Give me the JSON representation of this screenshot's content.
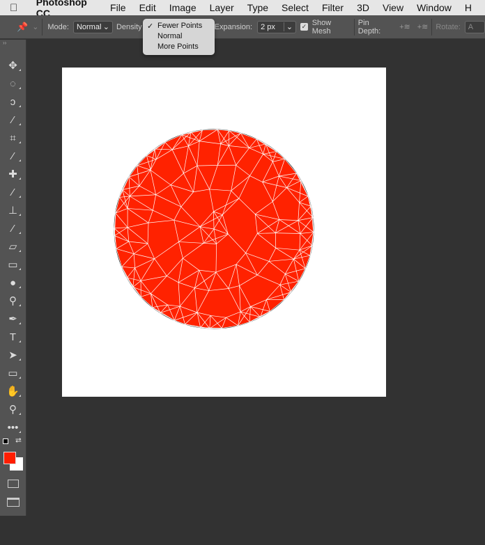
{
  "menubar": {
    "apple": "",
    "app": "Photoshop CC",
    "items": [
      "File",
      "Edit",
      "Image",
      "Layer",
      "Type",
      "Select",
      "Filter",
      "3D",
      "View",
      "Window",
      "H"
    ]
  },
  "options": {
    "mode_label": "Mode:",
    "mode_value": "Normal",
    "density_label": "Density",
    "expansion_label": "Expansion:",
    "expansion_value": "2 px",
    "show_mesh_label": "Show Mesh",
    "show_mesh_checked": true,
    "pin_depth_label": "Pin Depth:",
    "rotate_label": "Rotate:",
    "rotate_value": "A"
  },
  "density_menu": {
    "items": [
      "Fewer Points",
      "Normal",
      "More Points"
    ],
    "selected": "Fewer Points"
  },
  "tools": [
    {
      "name": "move",
      "glyph": "✥"
    },
    {
      "name": "marquee",
      "glyph": "◌"
    },
    {
      "name": "lasso",
      "glyph": "ↄ"
    },
    {
      "name": "magic-wand",
      "glyph": "⁄"
    },
    {
      "name": "crop",
      "glyph": "⌗"
    },
    {
      "name": "eyedropper",
      "glyph": "⁄"
    },
    {
      "name": "healing",
      "glyph": "✚"
    },
    {
      "name": "brush",
      "glyph": "⁄"
    },
    {
      "name": "stamp",
      "glyph": "⊥"
    },
    {
      "name": "history-brush",
      "glyph": "⁄"
    },
    {
      "name": "eraser",
      "glyph": "▱"
    },
    {
      "name": "gradient",
      "glyph": "▭"
    },
    {
      "name": "blur",
      "glyph": "●"
    },
    {
      "name": "dodge",
      "glyph": "⚲"
    },
    {
      "name": "pen",
      "glyph": "✒"
    },
    {
      "name": "type",
      "glyph": "T"
    },
    {
      "name": "path-selection",
      "glyph": "➤"
    },
    {
      "name": "rectangle",
      "glyph": "▭"
    },
    {
      "name": "hand",
      "glyph": "✋"
    },
    {
      "name": "zoom",
      "glyph": "⚲"
    },
    {
      "name": "more",
      "glyph": "•••"
    }
  ],
  "colors": {
    "foreground": "#ff1e00",
    "background": "#ffffff",
    "shape": "#ff2200"
  }
}
